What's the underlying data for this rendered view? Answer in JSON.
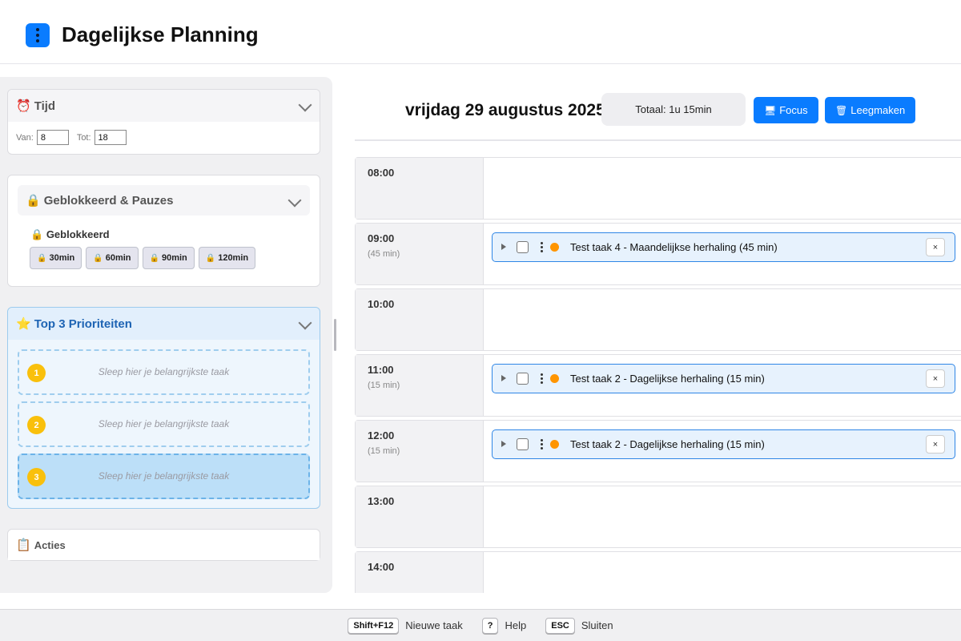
{
  "header": {
    "title": "Dagelijkse Planning"
  },
  "sidebar": {
    "tijd": {
      "title": "Tijd",
      "van_label": "Van:",
      "van_value": "8",
      "tot_label": "Tot:",
      "tot_value": "18"
    },
    "blocked": {
      "title": "Geblokkeerd & Pauzes",
      "subtitle": "Geblokkeerd",
      "buttons": [
        "30min",
        "60min",
        "90min",
        "120min"
      ]
    },
    "top3": {
      "title": "Top 3 Prioriteiten",
      "slots": [
        {
          "num": "1",
          "text": "Sleep hier je belangrijkste taak"
        },
        {
          "num": "2",
          "text": "Sleep hier je belangrijkste taak"
        },
        {
          "num": "3",
          "text": "Sleep hier je belangrijkste taak"
        }
      ]
    },
    "acties": {
      "title": "Acties"
    }
  },
  "main": {
    "date": "vrijdag 29 augustus 2025",
    "total": "Totaal: 1u 15min",
    "focus_label": "Focus",
    "clear_label": "Leegmaken",
    "rows": [
      {
        "time": "08:00",
        "duration": "",
        "task": ""
      },
      {
        "time": "09:00",
        "duration": "(45 min)",
        "task": "Test taak 4 - Maandelijkse herhaling (45 min)"
      },
      {
        "time": "10:00",
        "duration": "",
        "task": ""
      },
      {
        "time": "11:00",
        "duration": "(15 min)",
        "task": "Test taak 2 - Dagelijkse herhaling (15 min)"
      },
      {
        "time": "12:00",
        "duration": "(15 min)",
        "task": "Test taak 2 - Dagelijkse herhaling (15 min)"
      },
      {
        "time": "13:00",
        "duration": "",
        "task": ""
      },
      {
        "time": "14:00",
        "duration": "",
        "task": ""
      }
    ],
    "task_priority_color": "#ff9500",
    "remove_symbol": "×"
  },
  "footer": {
    "shortcuts": [
      {
        "key": "Shift+F12",
        "label": "Nieuwe taak"
      },
      {
        "key": "?",
        "label": "Help"
      },
      {
        "key": "ESC",
        "label": "Sluiten"
      }
    ]
  },
  "colors": {
    "accent": "#0a7cff",
    "top3_accent": "#1e64b4",
    "priority_badge": "#f9c00c"
  }
}
